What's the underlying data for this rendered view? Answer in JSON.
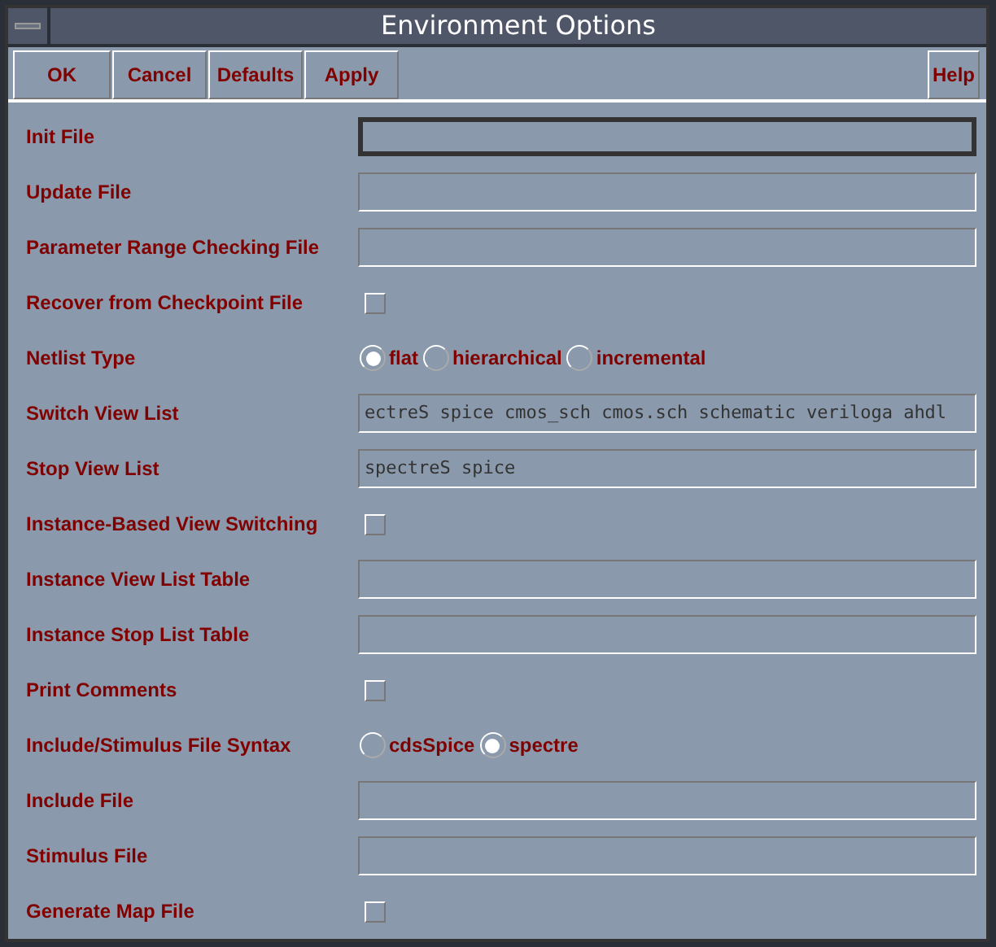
{
  "window": {
    "title": "Environment Options"
  },
  "buttons": [
    {
      "label": "OK"
    },
    {
      "label": "Cancel"
    },
    {
      "label": "Defaults"
    },
    {
      "label": "Apply"
    }
  ],
  "help_button": {
    "label": "Help"
  },
  "options": [
    {
      "label": "Init File",
      "kind": "text",
      "focused": true
    },
    {
      "label": "Update File",
      "kind": "text",
      "focused": false
    },
    {
      "label": "Parameter Range Checking File",
      "kind": "text",
      "focused": false
    },
    {
      "label": "Recover from Checkpoint File",
      "kind": "checkbox",
      "checked": false
    },
    {
      "label": "Netlist Type",
      "kind": "radio",
      "choices": [
        {
          "label": "flat",
          "selected": true
        },
        {
          "label": "hierarchical",
          "selected": false
        },
        {
          "label": "incremental",
          "selected": false
        }
      ]
    },
    {
      "label": "Switch View List",
      "kind": "text",
      "value": "ectreS spice cmos_sch cmos.sch schematic veriloga ahdl",
      "focused": false
    },
    {
      "label": "Stop View List",
      "kind": "text",
      "value": "spectreS spice",
      "focused": false
    },
    {
      "label": "Instance-Based View Switching",
      "kind": "checkbox",
      "checked": false
    },
    {
      "label": "Instance View List Table",
      "kind": "text",
      "focused": false
    },
    {
      "label": "Instance Stop List Table",
      "kind": "text",
      "focused": false
    },
    {
      "label": "Print Comments",
      "kind": "checkbox",
      "checked": false
    },
    {
      "label": "Include/Stimulus File Syntax",
      "kind": "radio",
      "choices": [
        {
          "label": "cdsSpice",
          "selected": false
        },
        {
          "label": "spectre",
          "selected": true
        }
      ]
    },
    {
      "label": "Include File",
      "kind": "text",
      "focused": false
    },
    {
      "label": "Stimulus File",
      "kind": "text",
      "focused": false
    },
    {
      "label": "Generate Map File",
      "kind": "checkbox",
      "checked": false
    }
  ]
}
